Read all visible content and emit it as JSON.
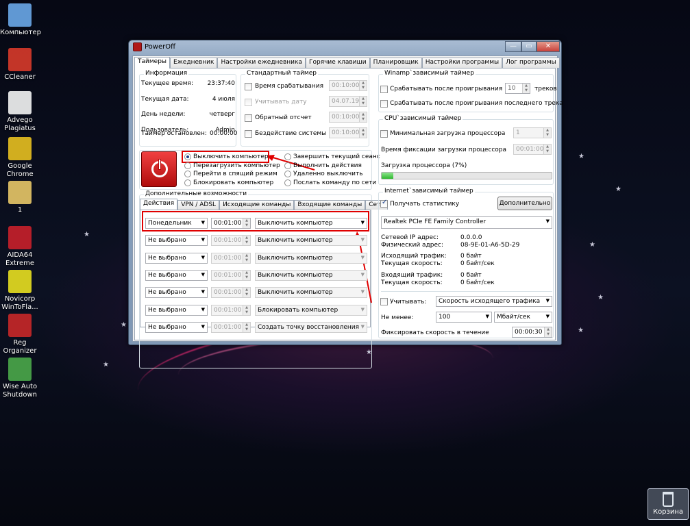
{
  "desktop": {
    "icons": [
      {
        "label": "Компьютер",
        "color": "#6aa8e8"
      },
      {
        "label": "CCleaner",
        "color": "#d83a2a"
      },
      {
        "label": "Advego Plagiatus",
        "color": "#f4f4f4"
      },
      {
        "label": "Google Chrome",
        "color": "#e8c020"
      },
      {
        "label": "1",
        "color": "#e8c868"
      },
      {
        "label": "AIDA64 Extreme",
        "color": "#c8202a"
      },
      {
        "label": "Novicorp WinToFla...",
        "color": "#e8e020"
      },
      {
        "label": "Reg Organizer",
        "color": "#c82828"
      },
      {
        "label": "Wise Auto Shutdown",
        "color": "#4aa84a"
      }
    ],
    "recycle_bin": "Корзина"
  },
  "window": {
    "title": "PowerOff",
    "controls": {
      "min": "—",
      "max": "▭",
      "close": "✕"
    },
    "close_color": "#c8403a"
  },
  "tabs": [
    "Таймеры",
    "Ежедневник",
    "Настройки ежедневника",
    "Горячие клавиши",
    "Планировщик",
    "Настройки программы",
    "Лог программы"
  ],
  "info": {
    "title": "Информация",
    "rows": [
      {
        "label": "Текущее время:",
        "value": "23:37:40"
      },
      {
        "label": "Текущая дата:",
        "value": "4 июля"
      },
      {
        "label": "День недели:",
        "value": "четверг"
      },
      {
        "label": "Пользователь:",
        "value": "Admin"
      }
    ],
    "stopped_label": "Таймер остановлен:",
    "stopped_value": "00:00:00"
  },
  "standard": {
    "title": "Стандартный таймер",
    "rows": [
      {
        "label": "Время срабатывания",
        "value": "00:10:00",
        "checked": false,
        "disabled": false
      },
      {
        "label": "Учитывать дату",
        "value": "04.07.19",
        "checked": false,
        "disabled": true
      },
      {
        "label": "Обратный отсчет",
        "value": "00:10:00",
        "checked": false,
        "disabled": false
      },
      {
        "label": "Бездействие системы",
        "value": "00:10:00",
        "checked": false,
        "disabled": false
      }
    ]
  },
  "actions": {
    "power_color": "#d81c1c",
    "left": [
      "Выключить компьютер",
      "Перезагрузить компьютер",
      "Перейти в спящий режим",
      "Блокировать компьютер"
    ],
    "right": [
      "Завершить текущий сеанс",
      "Выполнить действия",
      "Удаленно выключить",
      "Послать команду по сети"
    ],
    "selected": "Выключить компьютер"
  },
  "extra": {
    "title": "Дополнительные возможности",
    "subtabs": [
      "Действия",
      "VPN / ADSL",
      "Исходящие команды",
      "Входящие команды",
      "Сеть"
    ],
    "rows": [
      {
        "day": "Понедельник",
        "time": "00:01:00",
        "action": "Выключить компьютер",
        "enabled": true
      },
      {
        "day": "Не выбрано",
        "time": "00:01:00",
        "action": "Выключить компьютер",
        "enabled": false
      },
      {
        "day": "Не выбрано",
        "time": "00:01:00",
        "action": "Выключить компьютер",
        "enabled": false
      },
      {
        "day": "Не выбрано",
        "time": "00:01:00",
        "action": "Выключить компьютер",
        "enabled": false
      },
      {
        "day": "Не выбрано",
        "time": "00:01:00",
        "action": "Выключить компьютер",
        "enabled": false
      },
      {
        "day": "Не выбрано",
        "time": "00:01:00",
        "action": "Блокировать компьютер",
        "enabled": false
      },
      {
        "day": "Не выбрано",
        "time": "00:01:00",
        "action": "Создать точку восстановления",
        "enabled": false
      }
    ]
  },
  "winamp": {
    "title": "Winamp`зависимый таймер",
    "trigger_label": "Срабатывать после проигрывания",
    "tracks_value": "10",
    "tracks_unit": "треков",
    "last_label": "Срабатывать после проигрывания последнего трека"
  },
  "cpu": {
    "title": "CPU`зависимый таймер",
    "min_label": "Минимальная загрузка процессора",
    "min_value": "1",
    "fix_label": "Время фиксации загрузки процессора",
    "fix_value": "00:01:00",
    "load_label": "Загрузка процессора (7%)",
    "load_percent": 7
  },
  "internet": {
    "title": "Internet`зависимый таймер",
    "stats_label": "Получать статистику",
    "stats_checked": true,
    "more_button": "Дополнительно",
    "adapter": "Realtek PCIe FE Family Controller",
    "ip_label": "Сетевой IP адрес:",
    "ip_value": "0.0.0.0",
    "mac_label": "Физический адрес:",
    "mac_value": "08-9E-01-A6-5D-29",
    "out_label": "Исходящий трафик:",
    "out_value": "0 байт",
    "out_speed_label": "Текущая скорость:",
    "out_speed_value": "0 байт/сек",
    "in_label": "Входящий трафик:",
    "in_value": "0 байт",
    "in_speed_label": "Текущая скорость:",
    "in_speed_value": "0 байт/сек",
    "consider_label": "Учитывать:",
    "consider_value": "Скорость исходящего трафика",
    "not_less_label": "Не менее:",
    "not_less_value": "100",
    "unit_value": "Мбайт/сек",
    "fix_label": "Фиксировать скорость в течение",
    "fix_value": "00:00:30"
  }
}
